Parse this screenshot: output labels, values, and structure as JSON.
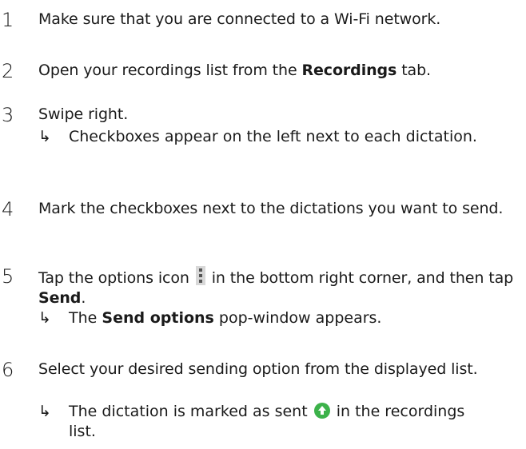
{
  "steps": [
    {
      "number": "1",
      "text": "Make sure that you are connected to a Wi-Fi network."
    },
    {
      "number": "2",
      "text_before": "Open your recordings list from the ",
      "bold": "Recordings",
      "text_after": " tab."
    },
    {
      "number": "3",
      "text": "Swipe right.",
      "result": "Checkboxes appear on the left next to each dictation."
    },
    {
      "number": "4",
      "text": "Mark the checkboxes next to the dictations you want to send."
    },
    {
      "number": "5",
      "text_before": "Tap the options icon ",
      "text_middle": " in the bottom right corner, and then tap ",
      "bold": "Send",
      "text_after": ".",
      "result_before": "The ",
      "result_bold": "Send options",
      "result_after": " pop-window appears."
    },
    {
      "number": "6",
      "text": "Select your desired sending option from the displayed list.",
      "result_before": "The dictation is marked as sent ",
      "result_after": " in the recordings list."
    }
  ],
  "result_arrow": "↳",
  "icons": {
    "options": "more-vert-icon",
    "sent": "sent-arrow-up-icon",
    "sent_color": "#3cb24a"
  }
}
